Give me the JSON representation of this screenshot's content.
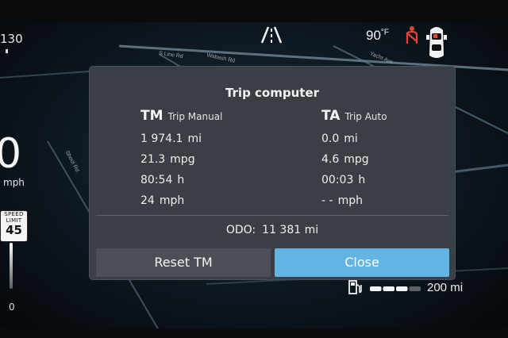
{
  "top_bar": {
    "left_number": "130",
    "temperature": "90",
    "temperature_unit": "°F",
    "seatbelt_color": "#e0443a"
  },
  "map": {
    "roads": [
      "S Line Rd",
      "Wabash Rd",
      "Yacht Ave",
      "Shoot Rd"
    ]
  },
  "speed": {
    "value": "0",
    "unit": "mph",
    "limit_line1": "SPEED",
    "limit_line2": "LIMIT",
    "limit_value": "45",
    "bar_zero": "0"
  },
  "dialog": {
    "title": "Trip computer",
    "tm": {
      "abbr": "TM",
      "label": "Trip Manual",
      "distance": "1 974.1",
      "distance_unit": "mi",
      "economy": "21.3",
      "economy_unit": "mpg",
      "time": "80:54",
      "time_unit": "h",
      "avg_speed": "24",
      "avg_speed_unit": "mph"
    },
    "ta": {
      "abbr": "TA",
      "label": "Trip Auto",
      "distance": "0.0",
      "distance_unit": "mi",
      "economy": "4.6",
      "economy_unit": "mpg",
      "time": "00:03",
      "time_unit": "h",
      "avg_speed": "- -",
      "avg_speed_unit": "mph"
    },
    "odo_label": "ODO:",
    "odo_value": "11 381",
    "odo_unit": "mi",
    "reset_label": "Reset TM",
    "close_label": "Close",
    "accent_color": "#62b4e4"
  },
  "fuel": {
    "level": 0.75,
    "range": "200",
    "range_unit": "mi"
  }
}
